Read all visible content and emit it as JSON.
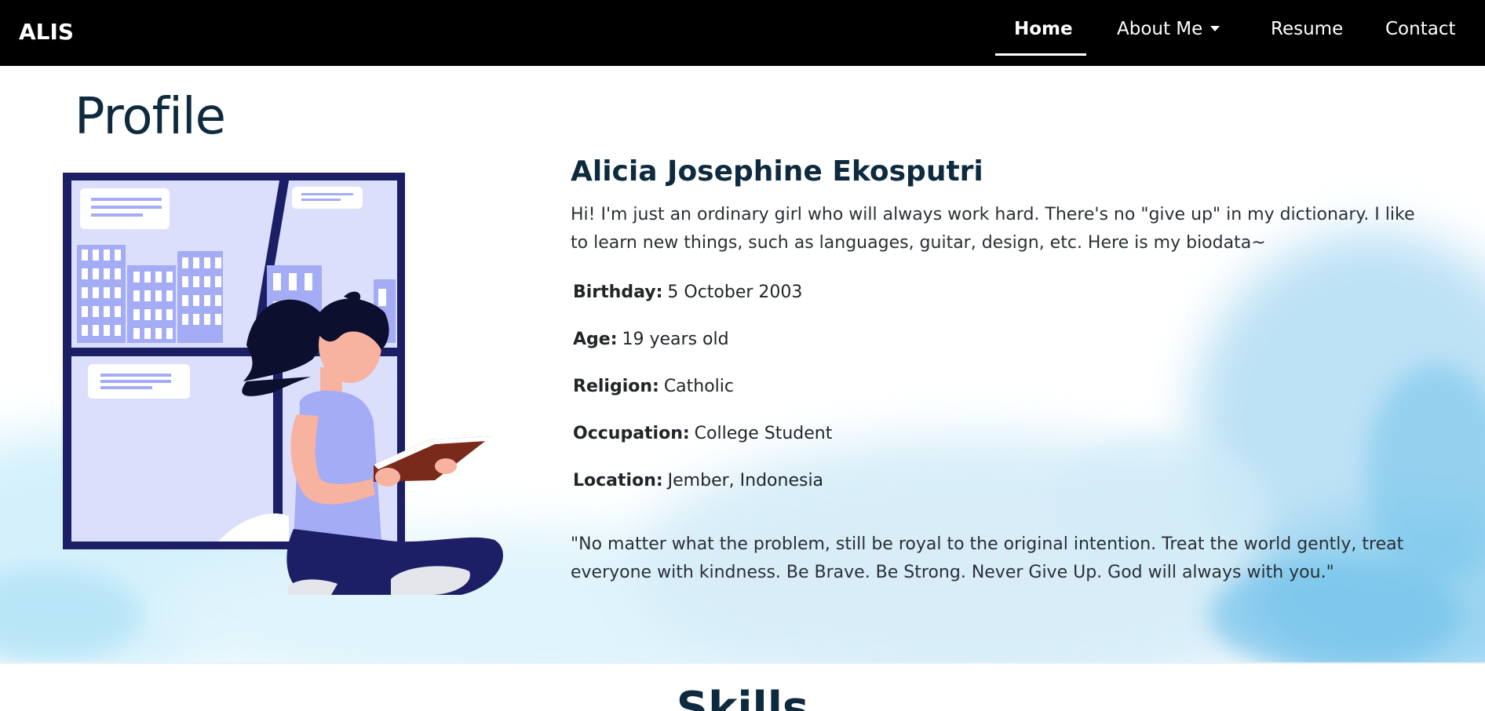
{
  "navbar": {
    "brand": "ALIS",
    "items": [
      {
        "label": "Home",
        "active": true
      },
      {
        "label": "About Me",
        "dropdown": true
      },
      {
        "label": "Resume"
      },
      {
        "label": "Contact"
      }
    ]
  },
  "profile": {
    "heading": "Profile",
    "name": "Alicia Josephine Ekosputri",
    "intro": "Hi! I'm just an ordinary girl who will always work hard. There's no \"give up\" in my dictionary. I like to learn new things, such as languages, guitar, design, etc. Here is my biodata~",
    "biodata": [
      {
        "label": "Birthday:",
        "value": "5 October 2003"
      },
      {
        "label": "Age:",
        "value": "19 years old"
      },
      {
        "label": "Religion:",
        "value": "Catholic"
      },
      {
        "label": "Occupation:",
        "value": "College Student"
      },
      {
        "label": "Location:",
        "value": "Jember, Indonesia"
      }
    ],
    "quote": "\"No matter what the problem, still be royal to the original intention. Treat the world gently, treat everyone with kindness. Be Brave. Be Strong. Never Give Up. God will always with you.\""
  },
  "skills": {
    "heading": "Skills"
  },
  "colors": {
    "navbar_bg": "#000000",
    "heading": "#0e2a3e",
    "window_frame": "#1d1f66",
    "window_fill": "#dcdffc",
    "building": "#a3acf4",
    "watercolor": "#8fd3f0"
  }
}
